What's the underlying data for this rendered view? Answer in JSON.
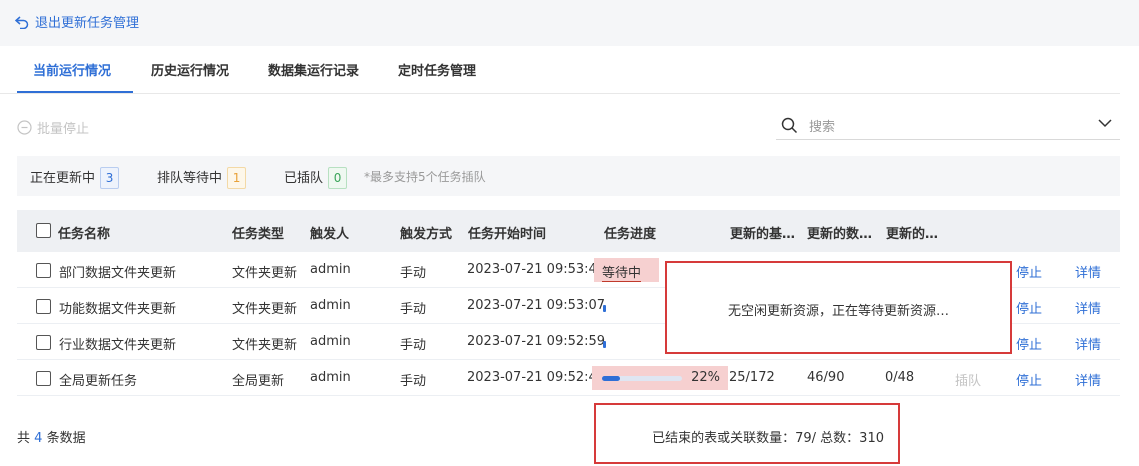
{
  "header": {
    "back_label": "退出更新任务管理"
  },
  "tabs": [
    {
      "label": "当前运行情况"
    },
    {
      "label": "历史运行情况"
    },
    {
      "label": "数据集运行记录"
    },
    {
      "label": "定时任务管理"
    }
  ],
  "toolbar": {
    "batch_stop": "批量停止",
    "search_placeholder": "搜索"
  },
  "status": {
    "updating_label": "正在更新中",
    "updating_count": "3",
    "queued_label": "排队等待中",
    "queued_count": "1",
    "inserted_label": "已插队",
    "inserted_count": "0",
    "hint": "*最多支持5个任务插队"
  },
  "table": {
    "headers": {
      "name": "任务名称",
      "type": "任务类型",
      "trigger_user": "触发人",
      "trigger_mode": "触发方式",
      "start_time": "任务开始时间",
      "progress": "任务进度",
      "col_a": "更新的基…",
      "col_b": "更新的数…",
      "col_c": "更新的…"
    },
    "rows": [
      {
        "name": "部门数据文件夹更新",
        "type": "文件夹更新",
        "user": "admin",
        "mode": "手动",
        "time": "2023-07-21 09:53:41",
        "progress_text": "等待中",
        "a": "",
        "b": "",
        "c": "",
        "insert": "",
        "stop": "停止",
        "detail": "详情"
      },
      {
        "name": "功能数据文件夹更新",
        "type": "文件夹更新",
        "user": "admin",
        "mode": "手动",
        "time": "2023-07-21 09:53:07",
        "progress_text": "",
        "a": "",
        "b": "",
        "c": "",
        "insert": "",
        "stop": "停止",
        "detail": "详情"
      },
      {
        "name": "行业数据文件夹更新",
        "type": "文件夹更新",
        "user": "admin",
        "mode": "手动",
        "time": "2023-07-21 09:52:59",
        "progress_text": "",
        "a": "",
        "b": "",
        "c": "",
        "insert": "",
        "stop": "停止",
        "detail": "详情"
      },
      {
        "name": "全局更新任务",
        "type": "全局更新",
        "user": "admin",
        "mode": "手动",
        "time": "2023-07-21 09:52:42",
        "progress_text": "22%",
        "progress_value": 0.22,
        "a": "25/172",
        "b": "46/90",
        "c": "0/48",
        "insert": "插队",
        "stop": "停止",
        "detail": "详情"
      }
    ]
  },
  "tooltip": {
    "message": "无空闲更新资源，正在等待更新资源…"
  },
  "footer": {
    "total_prefix": "共",
    "total_count": "4",
    "total_suffix": "条数据",
    "summary": "已结束的表或关联数量：79/ 总数：310"
  },
  "colors": {
    "accent": "#2f6fd6",
    "highlight": "#f6d0d0",
    "annotation_border": "#d63a3a"
  }
}
